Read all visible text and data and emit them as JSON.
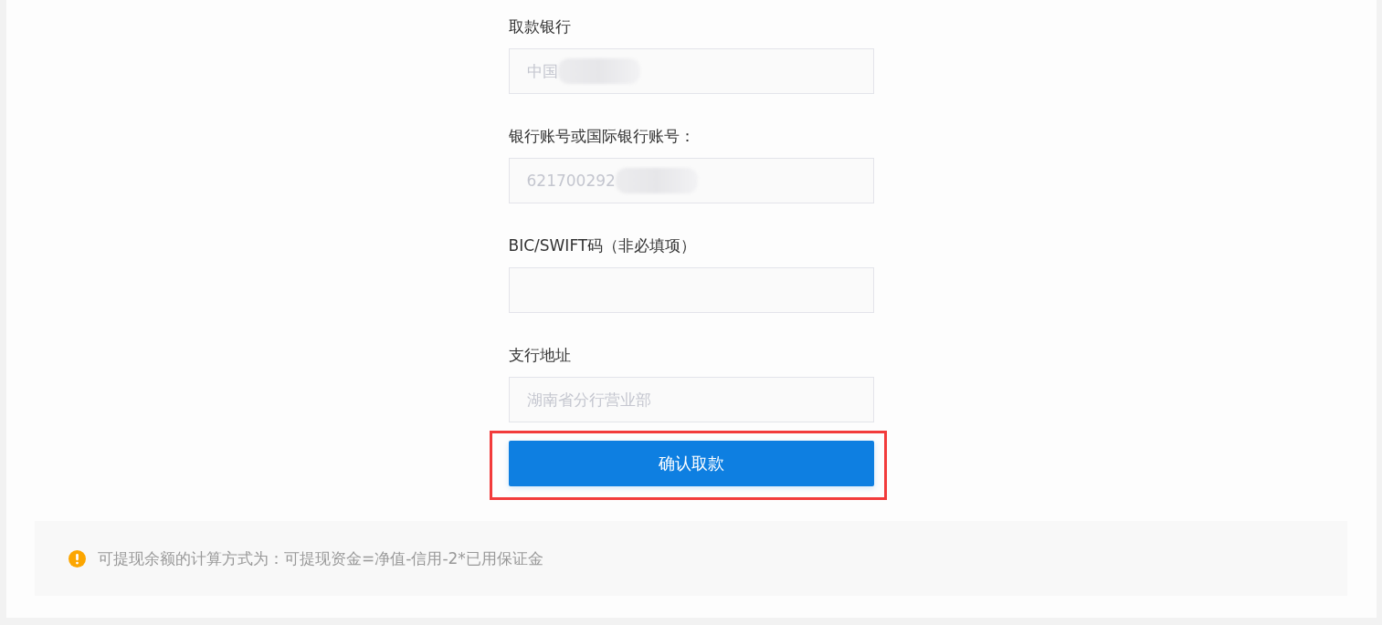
{
  "form": {
    "fields": [
      {
        "label": "取款银行",
        "value": "中国",
        "redacted": true
      },
      {
        "label": "银行账号或国际银行账号：",
        "value": "621700292",
        "redacted": true
      },
      {
        "label": "BIC/SWIFT码（非必填项）",
        "redacted": false
      },
      {
        "label": "支行地址",
        "value": "湖南省分行营业部",
        "redacted": false
      }
    ],
    "submit_button": {
      "label": "确认取款",
      "highlighted": true
    }
  },
  "notice": {
    "text": "可提现余额的计算方式为：可提现资金=净值-信用-2*已用保证金"
  }
}
